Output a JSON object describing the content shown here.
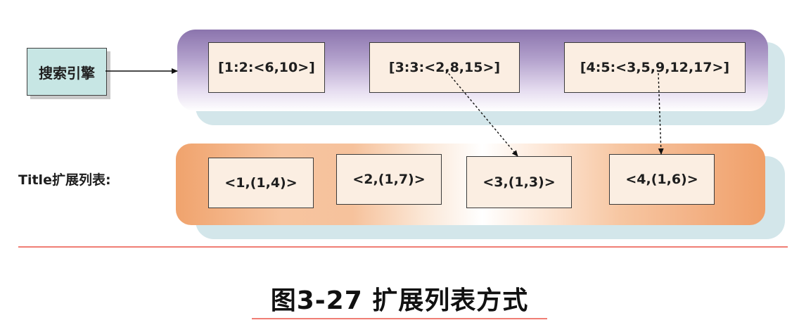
{
  "search_engine": {
    "label": "搜索引擎"
  },
  "index_row": {
    "nodes": [
      {
        "label": "[1:2:<6,10>]"
      },
      {
        "label": "[3:3:<2,8,15>]"
      },
      {
        "label": "[4:5:<3,5,9,12,17>]"
      }
    ]
  },
  "title_row": {
    "label": "Title扩展列表:",
    "nodes": [
      {
        "label": "<1,(1,4)>"
      },
      {
        "label": "<2,(1,7)>"
      },
      {
        "label": "<3,(1,3)>"
      },
      {
        "label": "<4,(1,6)>"
      }
    ]
  },
  "caption": "图3-27 扩展列表方式",
  "colors": {
    "accent_line": "#f07e75",
    "top_band": "#8b74ad",
    "bottom_band": "#f0a36d",
    "node_fill": "#fbeee2",
    "engine_fill": "#c7e6e4"
  }
}
